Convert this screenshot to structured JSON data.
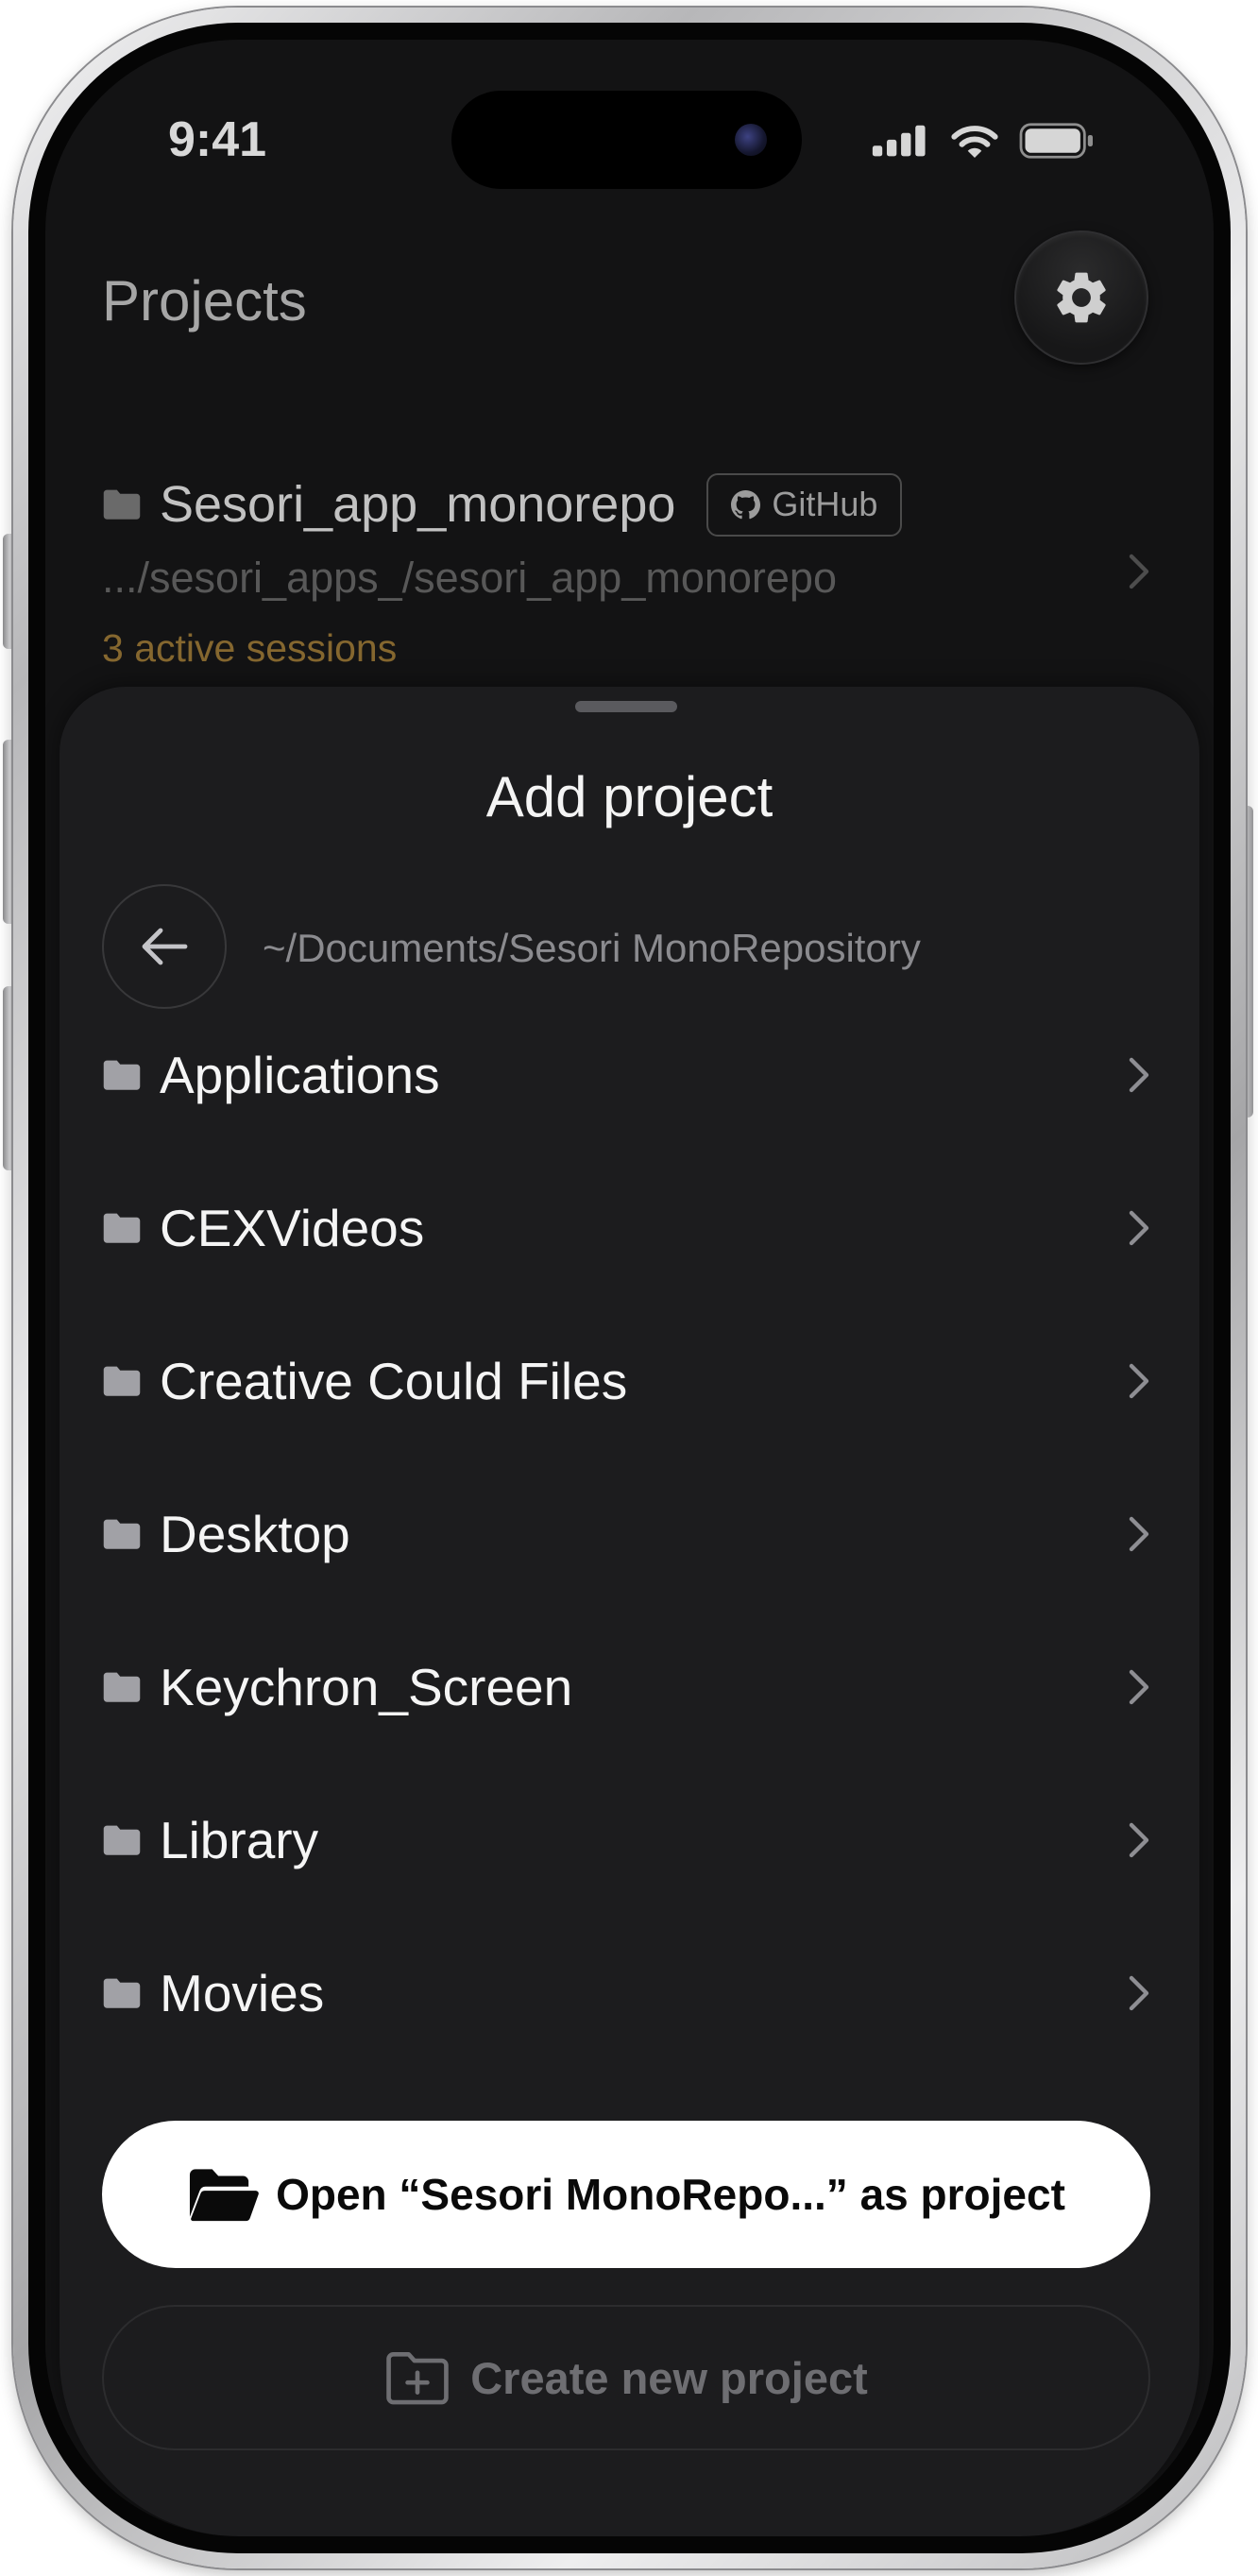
{
  "status_bar": {
    "time": "9:41",
    "icons": [
      "signal-icon",
      "wifi-icon",
      "battery-icon"
    ]
  },
  "header": {
    "title": "Projects",
    "settings_icon": "gear-icon"
  },
  "project_card": {
    "name": "Sesori_app_monorepo",
    "badge": "GitHub",
    "badge_icon": "github-icon",
    "path": ".../sesori_apps_/sesori_app_monorepo",
    "active_sessions": "3 active sessions"
  },
  "sheet": {
    "title": "Add project",
    "back_icon": "arrow-left-icon",
    "current_path": "~/Documents/Sesori MonoRepository",
    "folders": [
      {
        "name": "Applications"
      },
      {
        "name": "CEXVideos"
      },
      {
        "name": "Creative Could Files"
      },
      {
        "name": "Desktop"
      },
      {
        "name": "Keychron_Screen"
      },
      {
        "name": "Library"
      },
      {
        "name": "Movies"
      }
    ]
  },
  "actions": {
    "open_project_label": "Open “Sesori MonoRepo...” as project",
    "open_project_icon": "folder-open-icon",
    "create_project_label": "Create new project",
    "create_project_icon": "folder-plus-icon"
  },
  "colors": {
    "screen_background": "#131314",
    "sheet_background": "#1c1c1e",
    "sessions_accent": "#85672f",
    "primary_button": "#ffffff",
    "secondary_text": "#8b8b8f"
  }
}
